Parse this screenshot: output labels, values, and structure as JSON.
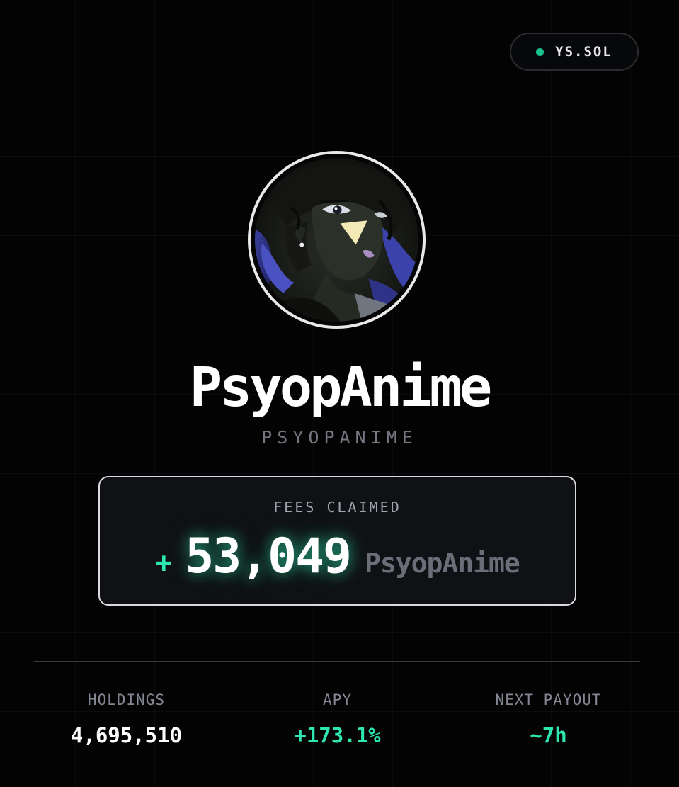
{
  "wallet": {
    "label": "YS.SOL",
    "status_color": "#1cc28e"
  },
  "profile": {
    "avatar_icon": "anime-character-avatar",
    "display_name": "PsyopAnime",
    "handle": "PSYOPANIME"
  },
  "fees": {
    "label": "FEES CLAIMED",
    "sign": "+",
    "value": "53,049",
    "unit": "PsyopAnime",
    "accent_color": "#2ee6b0"
  },
  "stats": [
    {
      "label": "HOLDINGS",
      "value": "4,695,510"
    },
    {
      "label": "APY",
      "value": "+173.1%"
    },
    {
      "label": "NEXT PAYOUT",
      "value": "~7h"
    }
  ]
}
